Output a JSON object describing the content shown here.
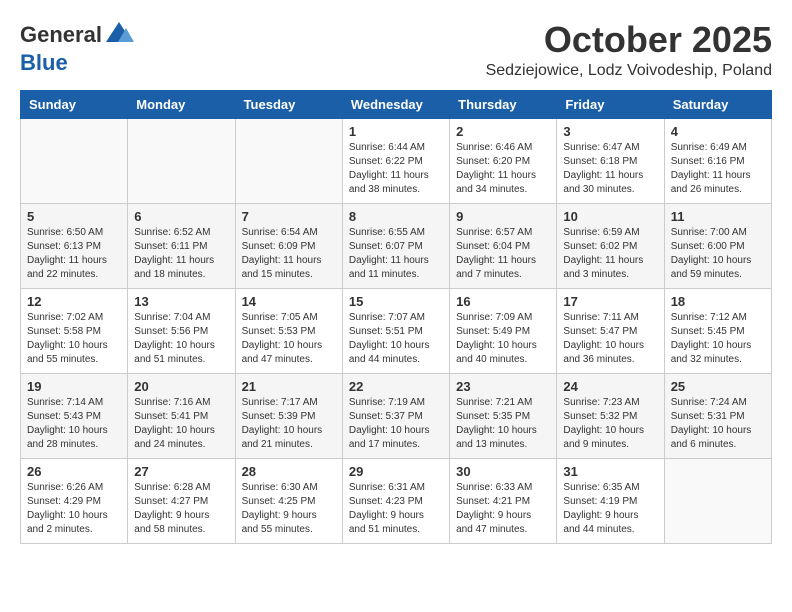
{
  "header": {
    "logo": {
      "general": "General",
      "blue": "Blue"
    },
    "title": "October 2025",
    "location": "Sedziejowice, Lodz Voivodeship, Poland"
  },
  "calendar": {
    "weekdays": [
      "Sunday",
      "Monday",
      "Tuesday",
      "Wednesday",
      "Thursday",
      "Friday",
      "Saturday"
    ],
    "rows": [
      {
        "shade": "white",
        "cells": [
          {
            "day": "",
            "info": ""
          },
          {
            "day": "",
            "info": ""
          },
          {
            "day": "",
            "info": ""
          },
          {
            "day": "1",
            "info": "Sunrise: 6:44 AM\nSunset: 6:22 PM\nDaylight: 11 hours\nand 38 minutes."
          },
          {
            "day": "2",
            "info": "Sunrise: 6:46 AM\nSunset: 6:20 PM\nDaylight: 11 hours\nand 34 minutes."
          },
          {
            "day": "3",
            "info": "Sunrise: 6:47 AM\nSunset: 6:18 PM\nDaylight: 11 hours\nand 30 minutes."
          },
          {
            "day": "4",
            "info": "Sunrise: 6:49 AM\nSunset: 6:16 PM\nDaylight: 11 hours\nand 26 minutes."
          }
        ]
      },
      {
        "shade": "shade",
        "cells": [
          {
            "day": "5",
            "info": "Sunrise: 6:50 AM\nSunset: 6:13 PM\nDaylight: 11 hours\nand 22 minutes."
          },
          {
            "day": "6",
            "info": "Sunrise: 6:52 AM\nSunset: 6:11 PM\nDaylight: 11 hours\nand 18 minutes."
          },
          {
            "day": "7",
            "info": "Sunrise: 6:54 AM\nSunset: 6:09 PM\nDaylight: 11 hours\nand 15 minutes."
          },
          {
            "day": "8",
            "info": "Sunrise: 6:55 AM\nSunset: 6:07 PM\nDaylight: 11 hours\nand 11 minutes."
          },
          {
            "day": "9",
            "info": "Sunrise: 6:57 AM\nSunset: 6:04 PM\nDaylight: 11 hours\nand 7 minutes."
          },
          {
            "day": "10",
            "info": "Sunrise: 6:59 AM\nSunset: 6:02 PM\nDaylight: 11 hours\nand 3 minutes."
          },
          {
            "day": "11",
            "info": "Sunrise: 7:00 AM\nSunset: 6:00 PM\nDaylight: 10 hours\nand 59 minutes."
          }
        ]
      },
      {
        "shade": "white",
        "cells": [
          {
            "day": "12",
            "info": "Sunrise: 7:02 AM\nSunset: 5:58 PM\nDaylight: 10 hours\nand 55 minutes."
          },
          {
            "day": "13",
            "info": "Sunrise: 7:04 AM\nSunset: 5:56 PM\nDaylight: 10 hours\nand 51 minutes."
          },
          {
            "day": "14",
            "info": "Sunrise: 7:05 AM\nSunset: 5:53 PM\nDaylight: 10 hours\nand 47 minutes."
          },
          {
            "day": "15",
            "info": "Sunrise: 7:07 AM\nSunset: 5:51 PM\nDaylight: 10 hours\nand 44 minutes."
          },
          {
            "day": "16",
            "info": "Sunrise: 7:09 AM\nSunset: 5:49 PM\nDaylight: 10 hours\nand 40 minutes."
          },
          {
            "day": "17",
            "info": "Sunrise: 7:11 AM\nSunset: 5:47 PM\nDaylight: 10 hours\nand 36 minutes."
          },
          {
            "day": "18",
            "info": "Sunrise: 7:12 AM\nSunset: 5:45 PM\nDaylight: 10 hours\nand 32 minutes."
          }
        ]
      },
      {
        "shade": "shade",
        "cells": [
          {
            "day": "19",
            "info": "Sunrise: 7:14 AM\nSunset: 5:43 PM\nDaylight: 10 hours\nand 28 minutes."
          },
          {
            "day": "20",
            "info": "Sunrise: 7:16 AM\nSunset: 5:41 PM\nDaylight: 10 hours\nand 24 minutes."
          },
          {
            "day": "21",
            "info": "Sunrise: 7:17 AM\nSunset: 5:39 PM\nDaylight: 10 hours\nand 21 minutes."
          },
          {
            "day": "22",
            "info": "Sunrise: 7:19 AM\nSunset: 5:37 PM\nDaylight: 10 hours\nand 17 minutes."
          },
          {
            "day": "23",
            "info": "Sunrise: 7:21 AM\nSunset: 5:35 PM\nDaylight: 10 hours\nand 13 minutes."
          },
          {
            "day": "24",
            "info": "Sunrise: 7:23 AM\nSunset: 5:32 PM\nDaylight: 10 hours\nand 9 minutes."
          },
          {
            "day": "25",
            "info": "Sunrise: 7:24 AM\nSunset: 5:31 PM\nDaylight: 10 hours\nand 6 minutes."
          }
        ]
      },
      {
        "shade": "white",
        "cells": [
          {
            "day": "26",
            "info": "Sunrise: 6:26 AM\nSunset: 4:29 PM\nDaylight: 10 hours\nand 2 minutes."
          },
          {
            "day": "27",
            "info": "Sunrise: 6:28 AM\nSunset: 4:27 PM\nDaylight: 9 hours\nand 58 minutes."
          },
          {
            "day": "28",
            "info": "Sunrise: 6:30 AM\nSunset: 4:25 PM\nDaylight: 9 hours\nand 55 minutes."
          },
          {
            "day": "29",
            "info": "Sunrise: 6:31 AM\nSunset: 4:23 PM\nDaylight: 9 hours\nand 51 minutes."
          },
          {
            "day": "30",
            "info": "Sunrise: 6:33 AM\nSunset: 4:21 PM\nDaylight: 9 hours\nand 47 minutes."
          },
          {
            "day": "31",
            "info": "Sunrise: 6:35 AM\nSunset: 4:19 PM\nDaylight: 9 hours\nand 44 minutes."
          },
          {
            "day": "",
            "info": ""
          }
        ]
      }
    ]
  }
}
